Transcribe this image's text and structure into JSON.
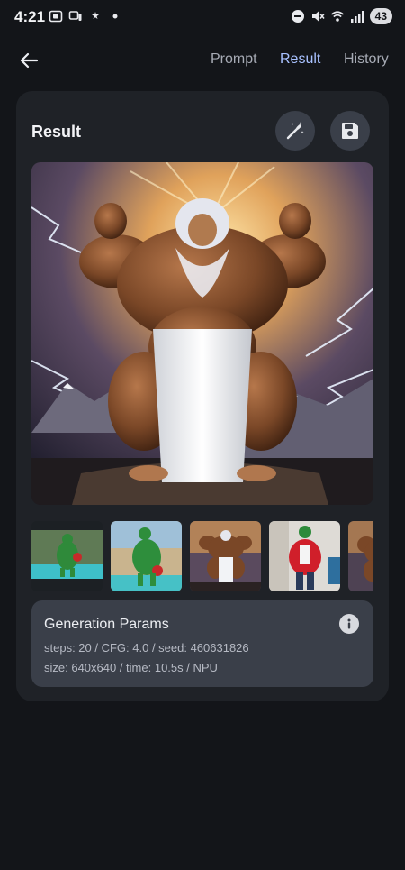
{
  "status_bar": {
    "time": "4:21",
    "battery": "43",
    "left_icons": [
      "screenshot-icon",
      "cast-icon",
      "weather-icon",
      "dot-icon"
    ],
    "right_icons": [
      "do-not-disturb-icon",
      "mute-icon",
      "wifi-icon",
      "signal-icon"
    ]
  },
  "nav": {
    "tabs": [
      {
        "label": "Prompt"
      },
      {
        "label": "Result",
        "active": true
      },
      {
        "label": "History"
      }
    ]
  },
  "result_card": {
    "title": "Result",
    "actions": [
      "magic-wand-icon",
      "save-icon"
    ]
  },
  "thumbnails": [
    {
      "name": "thumb-lizard-pool-1"
    },
    {
      "name": "thumb-lizard-pool-2"
    },
    {
      "name": "thumb-muscle-lion-selected"
    },
    {
      "name": "thumb-lizard-red-jacket"
    },
    {
      "name": "thumb-muscle-partial"
    }
  ],
  "params": {
    "title": "Generation Params",
    "line1": "steps: 20 / CFG: 4.0 / seed: 460631826",
    "line2": "size: 640x640 / time: 10.5s / NPU"
  },
  "colors": {
    "background": "#131519",
    "card": "#1f2227",
    "panel": "#3a3f49",
    "accent": "#a8c1ff"
  }
}
